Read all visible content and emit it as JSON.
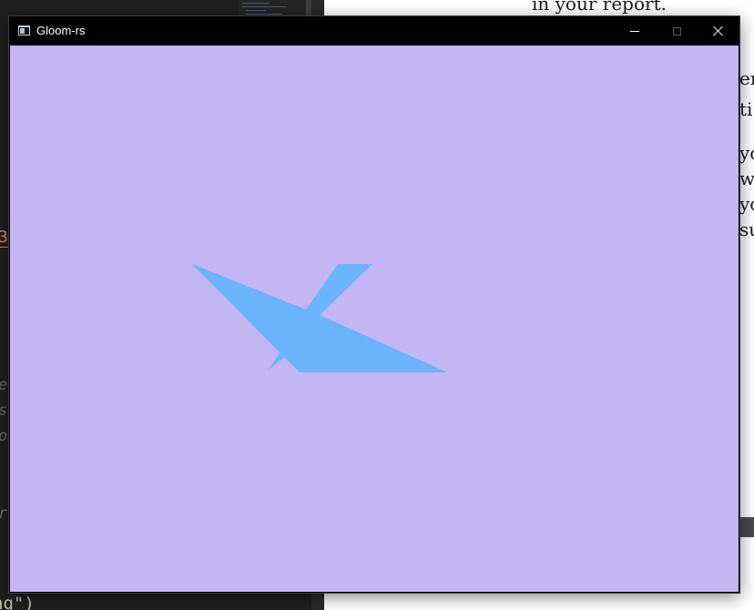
{
  "window": {
    "title": "Gloom-rs",
    "controls": {
      "minimize": "minimize-icon",
      "maximize": "maximize-icon",
      "close": "close-icon"
    }
  },
  "scene": {
    "clear_color": "#c4b5f3",
    "shape_color": "#6ab4fc",
    "shape_semantic": "blue-polygon-shape"
  },
  "background": {
    "editor": {
      "fragments": [
        "3",
        "e",
        "s",
        "o",
        "r.",
        "ng\")"
      ]
    },
    "pdf": {
      "lines": [
        "in your report.",
        "er",
        "ti",
        "yo",
        "w",
        "yo",
        "su"
      ]
    }
  }
}
